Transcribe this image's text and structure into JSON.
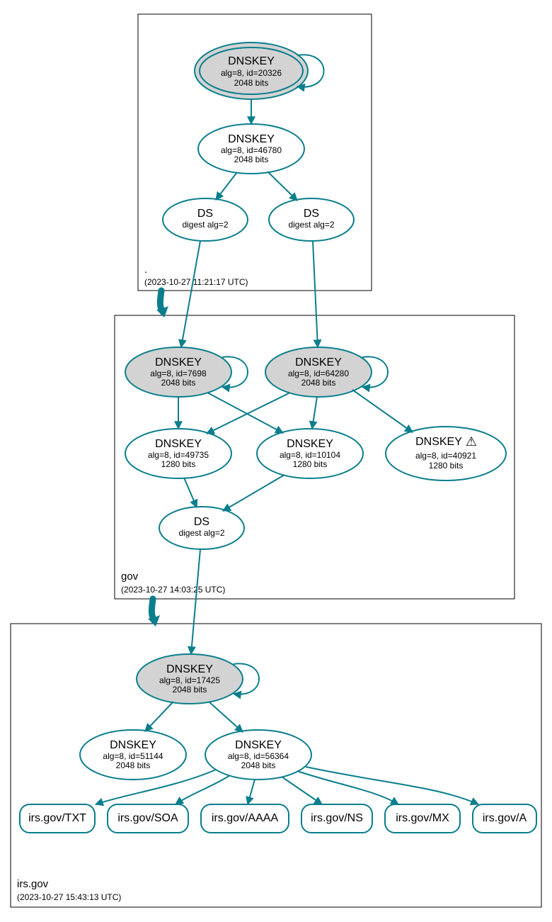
{
  "colors": {
    "stroke": "#0a7e8c",
    "ksk_fill": "#d3d3d3"
  },
  "zones": {
    "root": {
      "name": ".",
      "timestamp": "(2023-10-27 11:21:17 UTC)"
    },
    "gov": {
      "name": "gov",
      "timestamp": "(2023-10-27 14:03:25 UTC)"
    },
    "irs": {
      "name": "irs.gov",
      "timestamp": "(2023-10-27 15:43:13 UTC)"
    }
  },
  "nodes": {
    "root_ksk": {
      "title": "DNSKEY",
      "line2": "alg=8, id=20326",
      "line3": "2048 bits"
    },
    "root_zsk": {
      "title": "DNSKEY",
      "line2": "alg=8, id=46780",
      "line3": "2048 bits"
    },
    "root_ds1": {
      "title": "DS",
      "line2": "digest alg=2"
    },
    "root_ds2": {
      "title": "DS",
      "line2": "digest alg=2"
    },
    "gov_ksk1": {
      "title": "DNSKEY",
      "line2": "alg=8, id=7698",
      "line3": "2048 bits"
    },
    "gov_ksk2": {
      "title": "DNSKEY",
      "line2": "alg=8, id=64280",
      "line3": "2048 bits"
    },
    "gov_zsk1": {
      "title": "DNSKEY",
      "line2": "alg=8, id=49735",
      "line3": "1280 bits"
    },
    "gov_zsk2": {
      "title": "DNSKEY",
      "line2": "alg=8, id=10104",
      "line3": "1280 bits"
    },
    "gov_zsk3": {
      "title": "DNSKEY",
      "warn": "⚠",
      "line2": "alg=8, id=40921",
      "line3": "1280 bits"
    },
    "gov_ds": {
      "title": "DS",
      "line2": "digest alg=2"
    },
    "irs_ksk": {
      "title": "DNSKEY",
      "line2": "alg=8, id=17425",
      "line3": "2048 bits"
    },
    "irs_zsk1": {
      "title": "DNSKEY",
      "line2": "alg=8, id=51144",
      "line3": "2048 bits"
    },
    "irs_zsk2": {
      "title": "DNSKEY",
      "line2": "alg=8, id=56364",
      "line3": "2048 bits"
    },
    "rr_txt": {
      "label": "irs.gov/TXT"
    },
    "rr_soa": {
      "label": "irs.gov/SOA"
    },
    "rr_aaaa": {
      "label": "irs.gov/AAAA"
    },
    "rr_ns": {
      "label": "irs.gov/NS"
    },
    "rr_mx": {
      "label": "irs.gov/MX"
    },
    "rr_a": {
      "label": "irs.gov/A"
    }
  }
}
